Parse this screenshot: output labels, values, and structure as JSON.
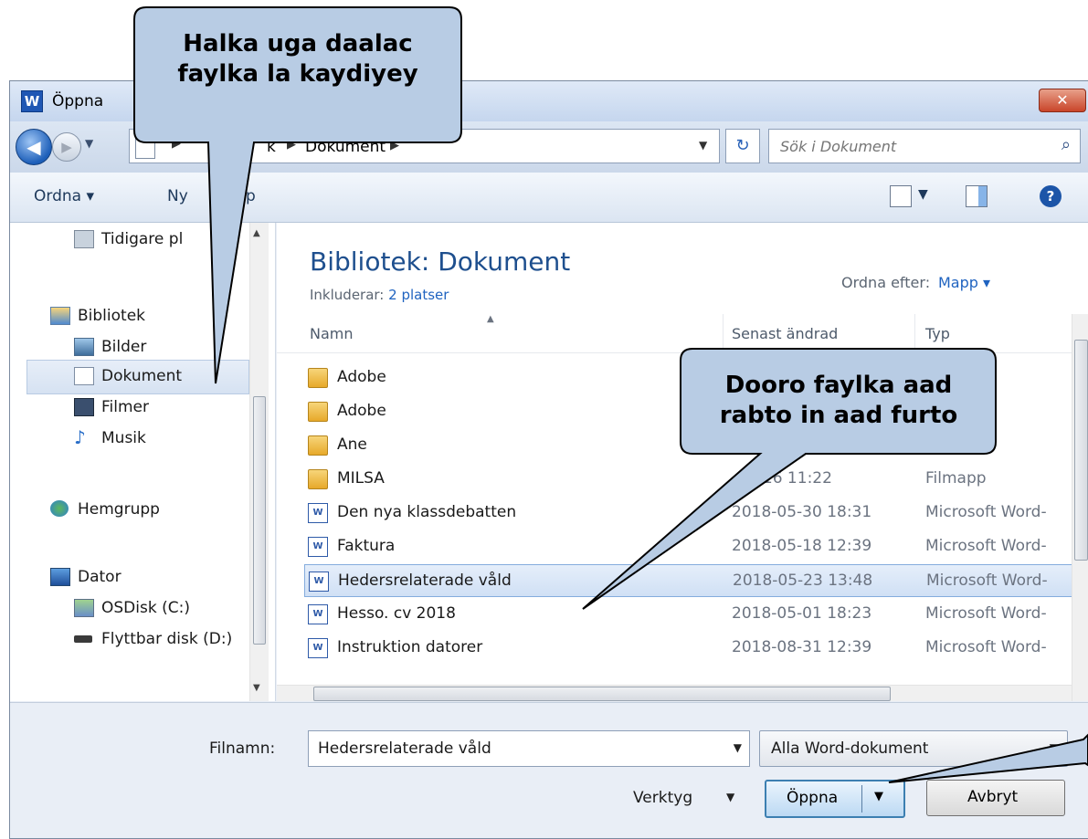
{
  "window": {
    "title": "Öppna",
    "app_icon": "word-app-icon",
    "close_icon": "close-icon"
  },
  "navigation": {
    "back_icon": "back-arrow-icon",
    "forward_icon": "forward-arrow-icon",
    "breadcrumb": [
      "k",
      "Dokument"
    ],
    "refresh_icon": "refresh-icon",
    "search_placeholder": "Sök i Dokument",
    "search_icon": "search-icon"
  },
  "toolbar": {
    "organize": "Ordna ▾",
    "new_folder": "Ny",
    "new_folder_suffix": "p"
  },
  "sidebar": {
    "items": [
      {
        "label": "Tidigare pl",
        "icon": "recent-places-icon"
      },
      {
        "label": "Bibliotek",
        "icon": "libraries-icon"
      },
      {
        "label": "Bilder",
        "icon": "pictures-icon"
      },
      {
        "label": "Dokument",
        "icon": "documents-icon",
        "selected": true
      },
      {
        "label": "Filmer",
        "icon": "videos-icon"
      },
      {
        "label": "Musik",
        "icon": "music-icon"
      },
      {
        "label": "Hemgrupp",
        "icon": "homegroup-icon"
      },
      {
        "label": "Dator",
        "icon": "computer-icon"
      },
      {
        "label": "OSDisk (C:)",
        "icon": "drive-icon"
      },
      {
        "label": "Flyttbar disk (D:)",
        "icon": "removable-drive-icon"
      }
    ]
  },
  "library": {
    "title": "Bibliotek: Dokument",
    "includes_label": "Inkluderar:",
    "includes_link": "2 platser",
    "sort_label": "Ordna efter:",
    "sort_value": "Mapp ▾"
  },
  "columns": [
    "Namn",
    "Senast ändrad",
    "Typ"
  ],
  "files": [
    {
      "name": "Adobe",
      "date": "",
      "type": "",
      "kind": "folder"
    },
    {
      "name": "Adobe",
      "date": "",
      "type": "",
      "kind": "folder"
    },
    {
      "name": "Ane",
      "date": "",
      "type": "",
      "kind": "folder"
    },
    {
      "name": "MILSA",
      "date": "-10-16 11:22",
      "type": "Filmapp",
      "kind": "folder"
    },
    {
      "name": "Den nya klassdebatten",
      "date": "2018-05-30 18:31",
      "type": "Microsoft Word-",
      "kind": "word"
    },
    {
      "name": "Faktura",
      "date": "2018-05-18 12:39",
      "type": "Microsoft Word-",
      "kind": "word"
    },
    {
      "name": "Hedersrelaterade våld",
      "date": "2018-05-23 13:48",
      "type": "Microsoft Word-",
      "kind": "word",
      "selected": true
    },
    {
      "name": "Hesso. cv  2018",
      "date": "2018-05-01 18:23",
      "type": "Microsoft Word-",
      "kind": "word"
    },
    {
      "name": "Instruktion datorer",
      "date": "2018-08-31 12:39",
      "type": "Microsoft Word-",
      "kind": "word"
    }
  ],
  "footer": {
    "filename_label": "Filnamn:",
    "filename_value": "Hedersrelaterade våld",
    "filter_value": "Alla Word-dokument",
    "tools_label": "Verktyg",
    "open_label": "Öppna",
    "cancel_label": "Avbryt"
  },
  "callouts": {
    "top_lines": [
      "Halka uga daalac",
      "faylka la kaydiyey"
    ],
    "middle_lines": [
      "Dooro faylka aad",
      "rabto in aad furto"
    ],
    "fill_color": "#b8cce4"
  }
}
